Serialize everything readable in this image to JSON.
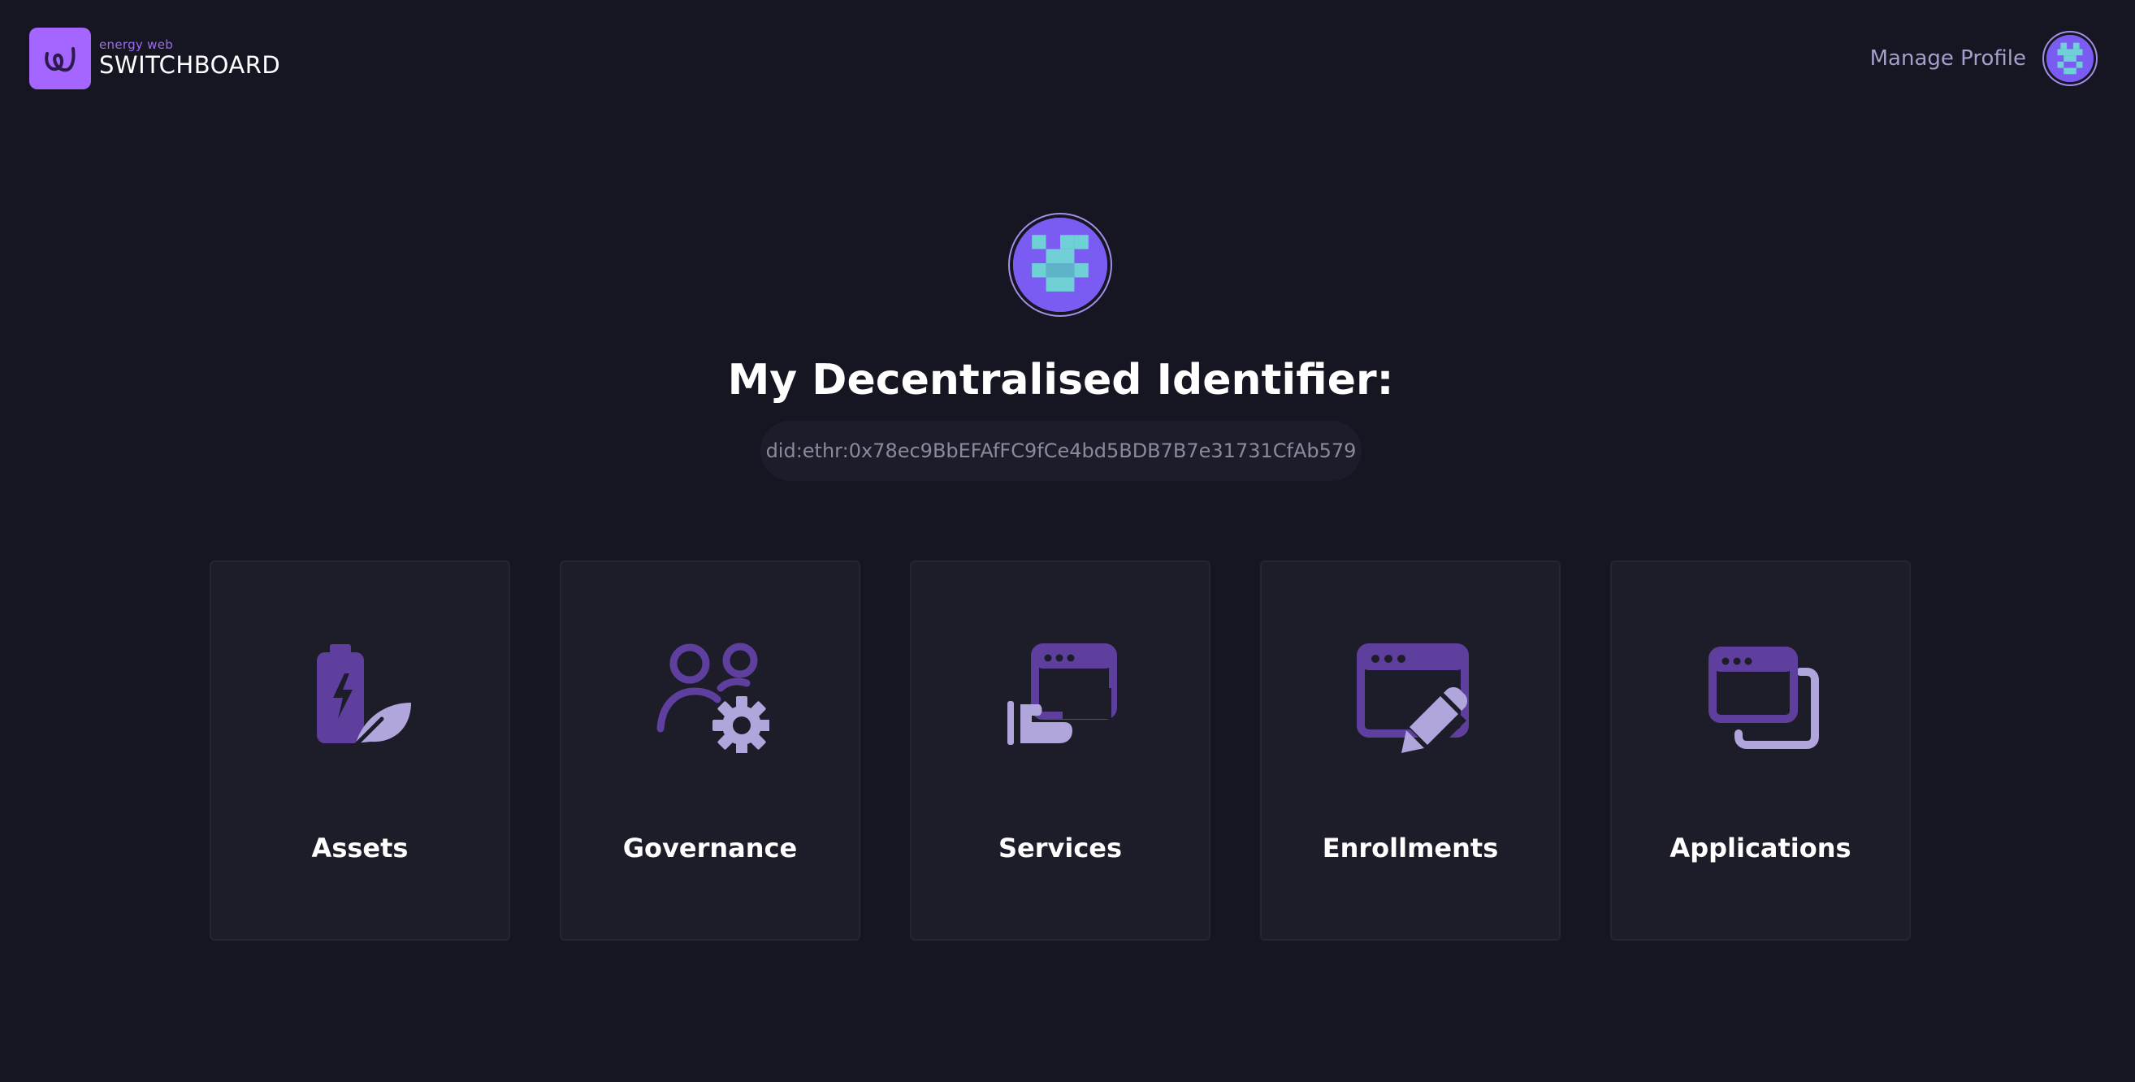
{
  "brand": {
    "subtitle": "energy web",
    "name": "SWITCHBOARD",
    "accent_color": "#a466ff"
  },
  "header": {
    "manage_profile_label": "Manage Profile"
  },
  "identity": {
    "title": "My Decentralised Identifier:",
    "did": "did:ethr:0x78ec9BbEFAfFC9fCe4bd5BDB7B7e31731CfAb579",
    "avatar_colors": {
      "background": "#7b5cf2",
      "pattern": "#6fd0d6"
    }
  },
  "cards": [
    {
      "label": "Assets",
      "icon": "battery-leaf-icon"
    },
    {
      "label": "Governance",
      "icon": "users-gear-icon"
    },
    {
      "label": "Services",
      "icon": "hand-window-icon"
    },
    {
      "label": "Enrollments",
      "icon": "window-pencil-icon"
    },
    {
      "label": "Applications",
      "icon": "stacked-windows-icon"
    }
  ],
  "colors": {
    "background": "#161622",
    "card_background": "#1d1c29",
    "icon_dark": "#5f3f9e",
    "icon_light": "#b0a6db"
  }
}
